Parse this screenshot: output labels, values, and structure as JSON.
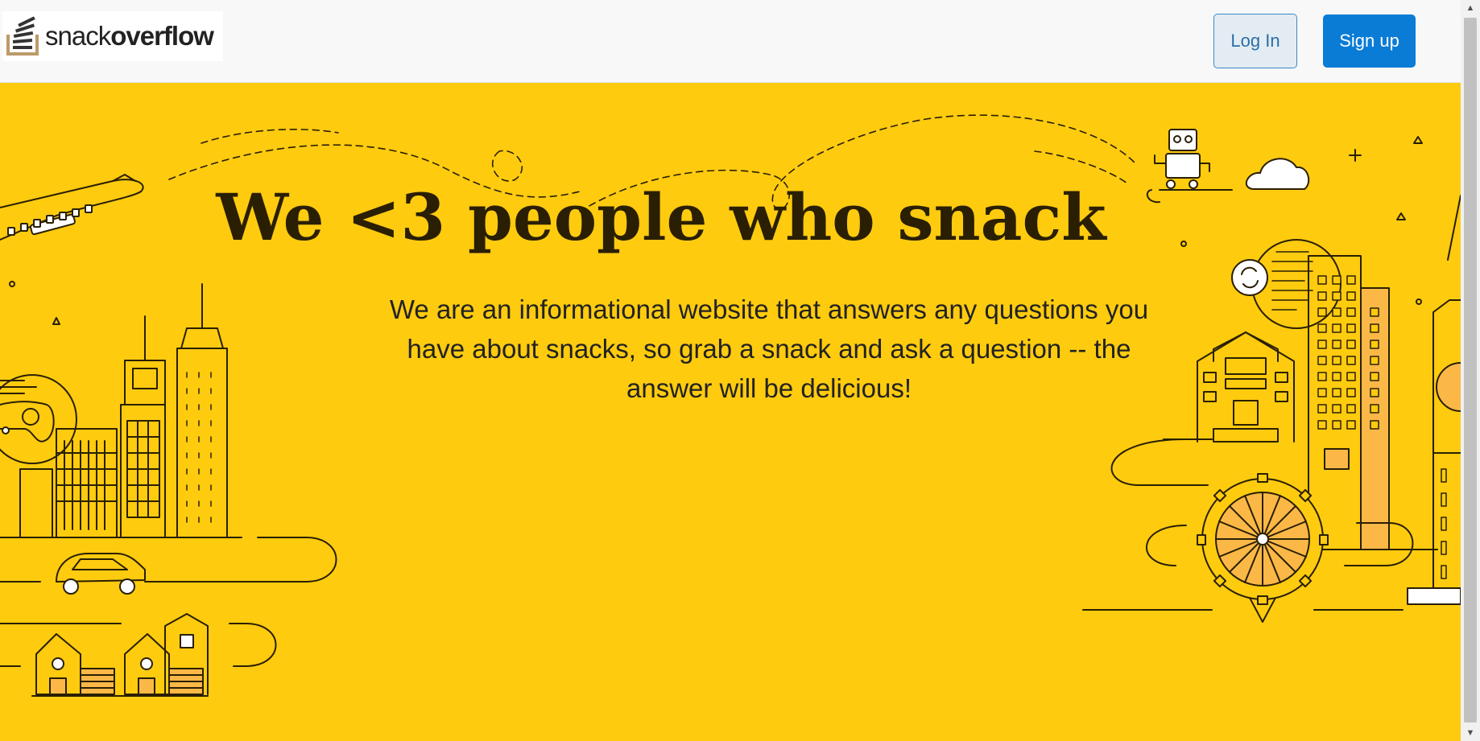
{
  "header": {
    "logo": {
      "word_light": "snack",
      "word_bold": "overflow"
    },
    "login_label": "Log In",
    "signup_label": "Sign up"
  },
  "hero": {
    "title": "We <3 people who snack",
    "text": "We are an informational website that answers any questions you have about snacks, so grab a snack and ask a question -- the answer will be delicious!",
    "background_color": "#fecb0f"
  },
  "scrollbar": {
    "up_icon": "scroll-up-arrow-icon",
    "down_icon": "scroll-down-arrow-icon"
  }
}
